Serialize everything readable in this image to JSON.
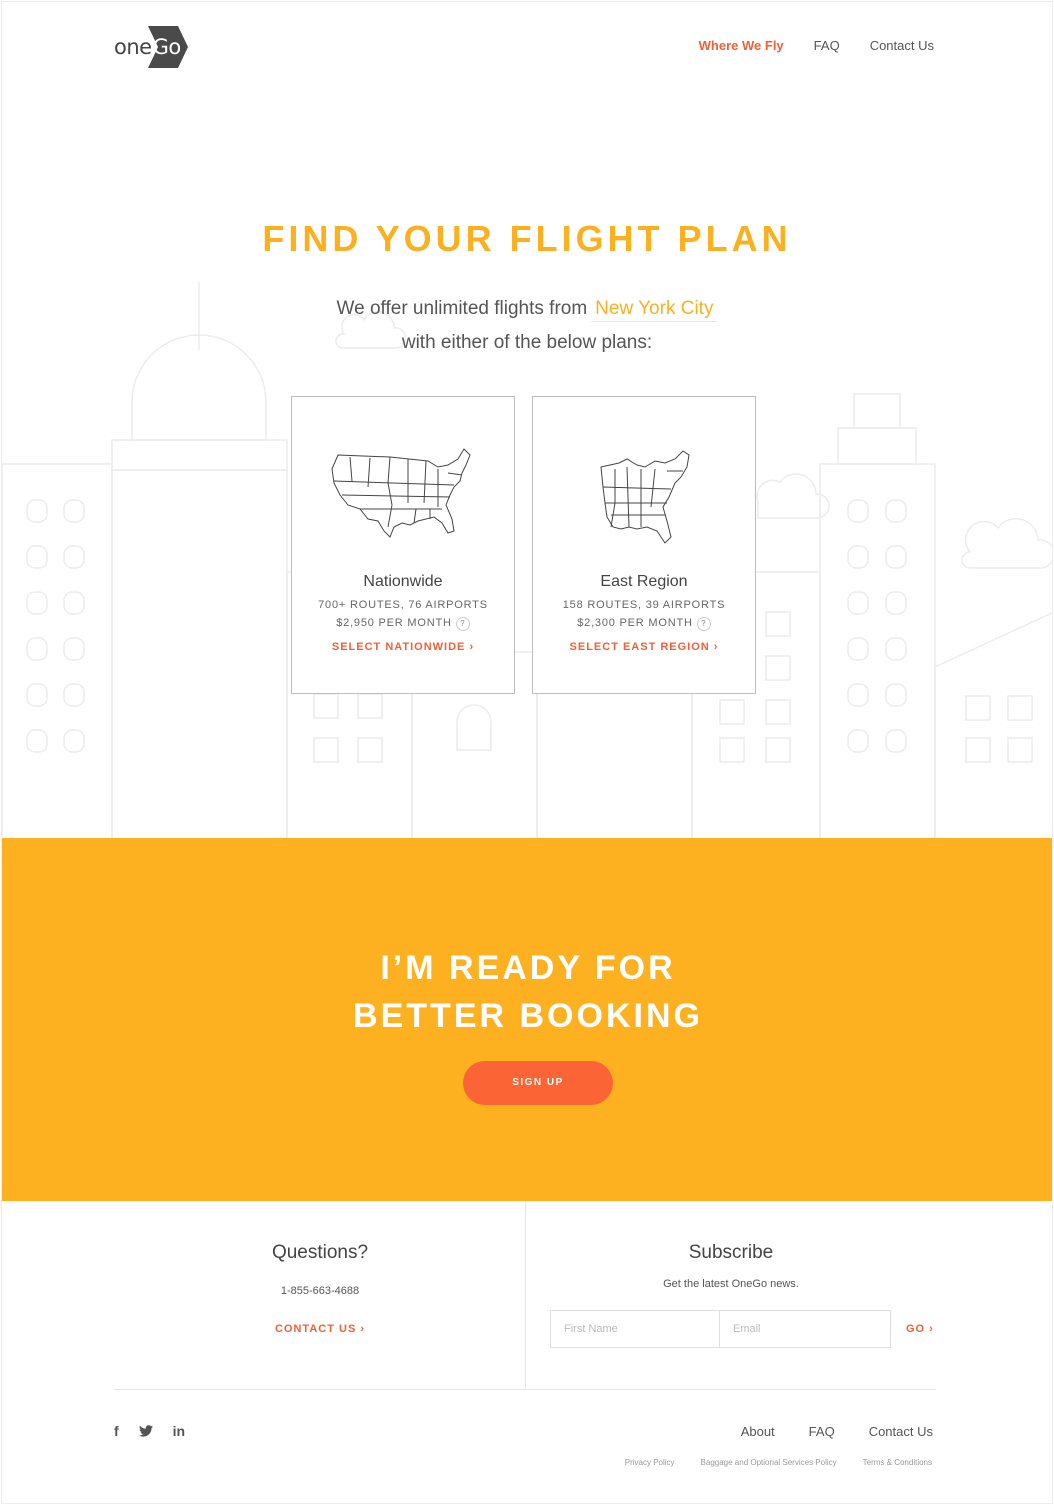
{
  "header": {
    "logo_one": "one",
    "logo_go": "Go",
    "nav": [
      {
        "label": "Where We Fly",
        "active": true
      },
      {
        "label": "FAQ",
        "active": false
      },
      {
        "label": "Contact Us",
        "active": false
      }
    ]
  },
  "hero": {
    "title": "FIND YOUR FLIGHT PLAN",
    "subtitle_line1": "We offer unlimited flights from",
    "city": "New York City",
    "subtitle_line2": "with either of the below plans:"
  },
  "plans": [
    {
      "name": "Nationwide",
      "routes": "700+ ROUTES, 76 AIRPORTS",
      "price": "$2,950 PER MONTH",
      "help": "?",
      "select": "SELECT NATIONWIDE ›",
      "icon": "usa-map-icon"
    },
    {
      "name": "East Region",
      "routes": "158 ROUTES, 39 AIRPORTS",
      "price": "$2,300 PER MONTH",
      "help": "?",
      "select": "SELECT EAST REGION ›",
      "icon": "east-region-map-icon"
    }
  ],
  "cta": {
    "line1": "I’M READY FOR",
    "line2": "BETTER BOOKING",
    "button": "SIGN UP"
  },
  "questions": {
    "title": "Questions?",
    "phone": "1-855-663-4688",
    "contact": "CONTACT US ›"
  },
  "subscribe": {
    "title": "Subscribe",
    "subtitle": "Get the latest OneGo news.",
    "first_name_placeholder": "First Name",
    "email_placeholder": "Email",
    "go": "GO ›"
  },
  "social": {
    "facebook": "f",
    "twitter": "twitter-icon",
    "linkedin": "in"
  },
  "footer_nav": [
    "About",
    "FAQ",
    "Contact Us"
  ],
  "legal": [
    "Privacy Policy",
    "Baggage and Optional Services Policy",
    "Terms & Conditions"
  ],
  "colors": {
    "accent_yellow": "#fdb121",
    "accent_orange": "#f45f35",
    "signup_orange": "#fb6434"
  }
}
